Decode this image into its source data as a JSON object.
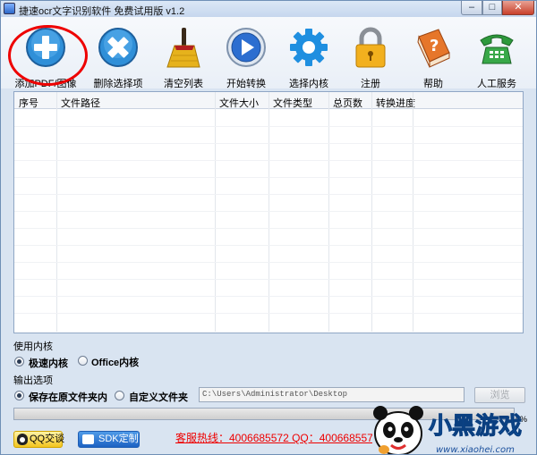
{
  "window": {
    "title": "捷速ocr文字识别软件 免费试用版 v1.2",
    "min": "–",
    "max": "□",
    "close": "✕"
  },
  "toolbar": [
    {
      "id": "add",
      "label": "添加PDF/图像",
      "icon": "plus-circle-icon"
    },
    {
      "id": "delete",
      "label": "删除选择项",
      "icon": "x-circle-icon"
    },
    {
      "id": "clear",
      "label": "清空列表",
      "icon": "broom-icon"
    },
    {
      "id": "start",
      "label": "开始转换",
      "icon": "play-icon"
    },
    {
      "id": "kernel",
      "label": "选择内核",
      "icon": "gear-icon"
    },
    {
      "id": "register",
      "label": "注册",
      "icon": "lock-icon"
    },
    {
      "id": "help",
      "label": "帮助",
      "icon": "help-book-icon"
    },
    {
      "id": "service",
      "label": "人工服务",
      "icon": "phone-icon"
    }
  ],
  "table": {
    "columns": [
      "序号",
      "文件路径",
      "文件大小",
      "文件类型",
      "总页数",
      "转换进度"
    ],
    "rows": []
  },
  "kernel": {
    "heading": "使用内核",
    "options": [
      "极速内核",
      "Office内核"
    ],
    "selected": 0
  },
  "output": {
    "heading": "输出选项",
    "options": [
      "保存在原文件夹内",
      "自定义文件夹"
    ],
    "selected": 0,
    "path": "C:\\Users\\Administrator\\Desktop",
    "browse": "浏览"
  },
  "progress": {
    "value": 0,
    "label": "0%"
  },
  "footer": {
    "qq": "QQ交谈",
    "sdk": "SDK定制",
    "hotline": "客服热线：4006685572 QQ：4006685572"
  },
  "watermark": {
    "text": "小黑游戏",
    "url": "www.xiaohei.com"
  },
  "colors": {
    "accent": "#1d62c3",
    "hotline": "#e00000",
    "highlight_ring": "#e00000"
  }
}
